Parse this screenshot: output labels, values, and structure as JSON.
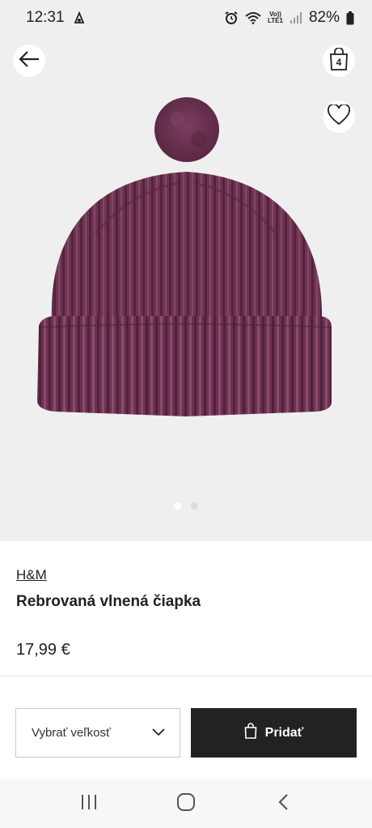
{
  "status": {
    "time": "12:31",
    "battery": "82%",
    "network_line1": "Vo))",
    "network_line2": "LTE1"
  },
  "hero": {
    "bag_count": "4",
    "image_colors": {
      "background": "#efefef",
      "hat_main": "#6f3452",
      "hat_dark": "#52243b",
      "hat_light": "#84476a"
    },
    "carousel": {
      "total": 2,
      "active": 0
    }
  },
  "product": {
    "brand": "H&M",
    "title": "Rebrovaná vlnená čiapka",
    "price": "17,99 €"
  },
  "actions": {
    "size_placeholder": "Vybrať veľkosť",
    "add_label": "Pridať"
  },
  "colors": {
    "accent": "#222222"
  }
}
